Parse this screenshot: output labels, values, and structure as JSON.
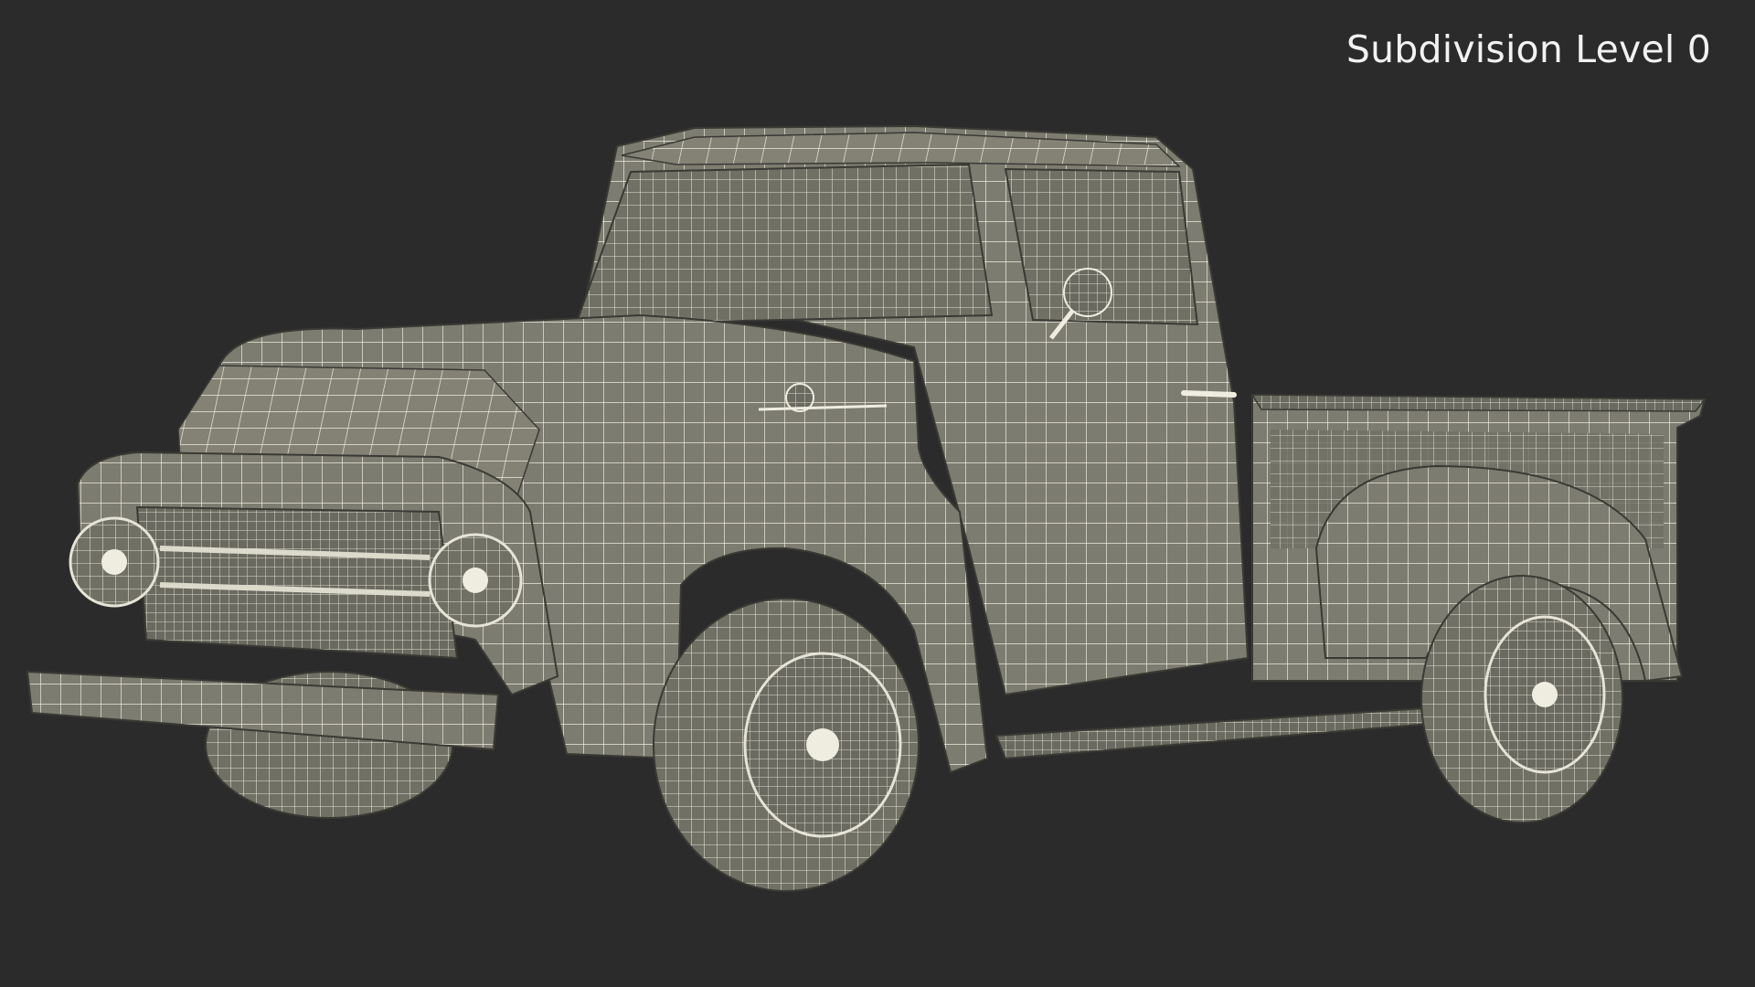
{
  "overlay": {
    "label": "Subdivision Level 0"
  },
  "scene": {
    "background_color": "#2b2b2b",
    "mesh_fill_color": "#7d7c70",
    "wire_color": "#eceadc",
    "subject": "truck-wireframe-render"
  }
}
